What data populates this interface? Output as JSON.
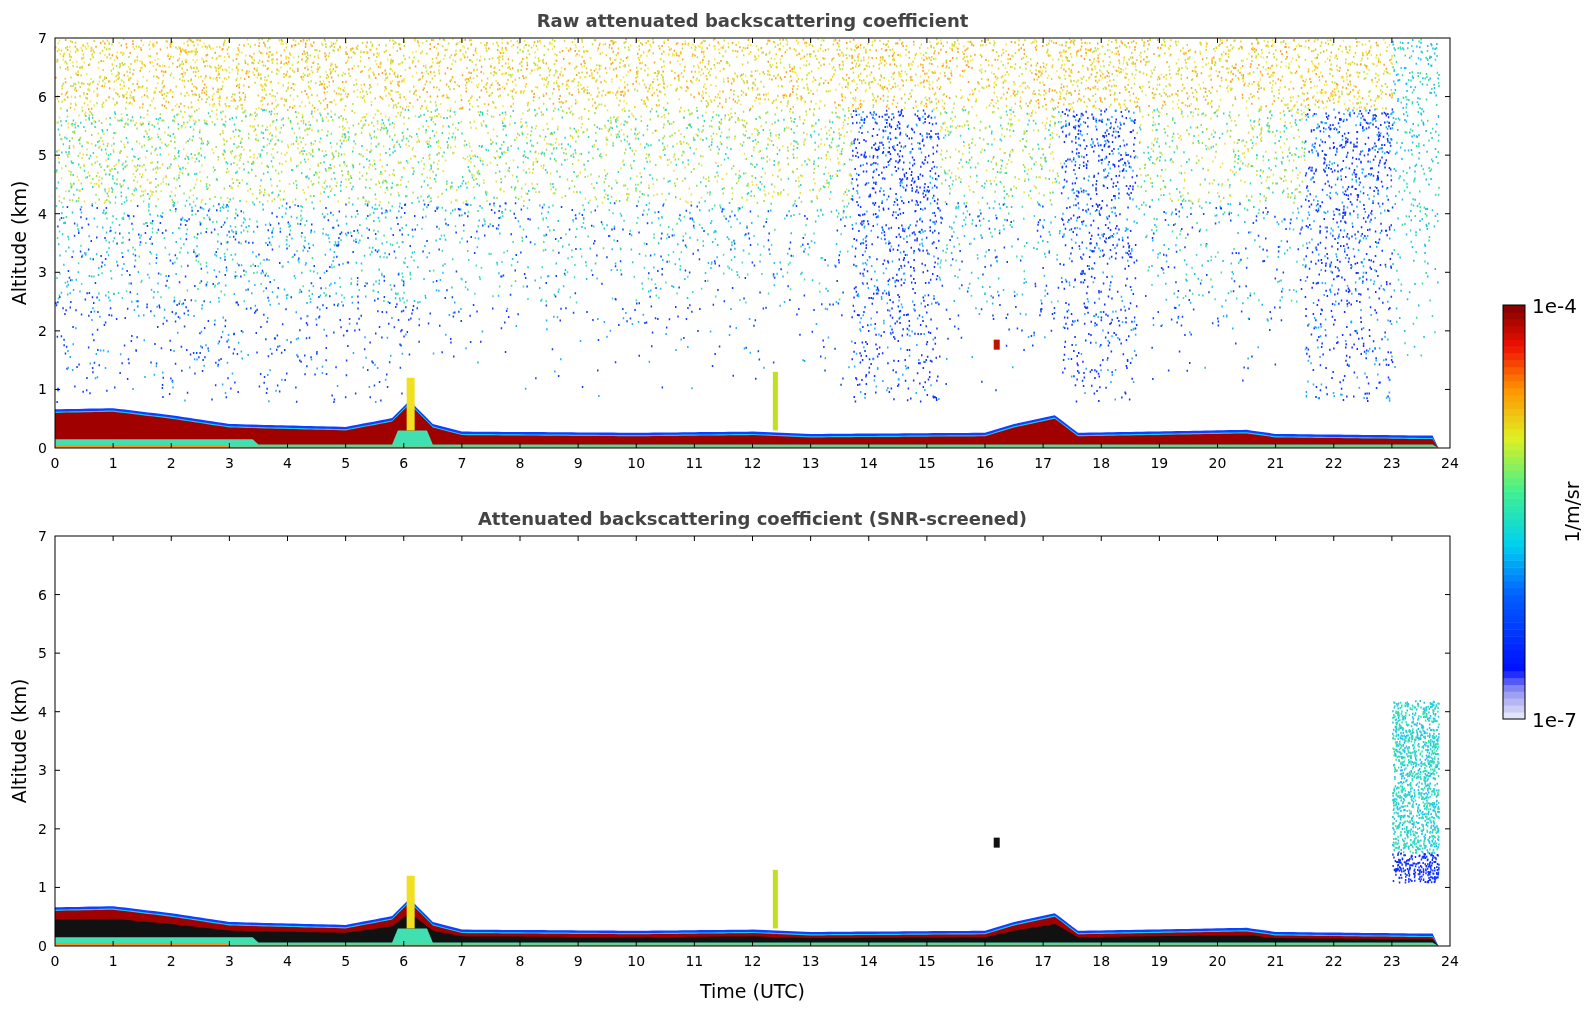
{
  "panels": [
    {
      "kind": "raw",
      "title": "Raw attenuated backscattering coefficient",
      "ylabel": "Altitude (km)",
      "yticks": [
        "7",
        "6",
        "5",
        "4",
        "3",
        "2",
        "1",
        "0"
      ],
      "xticks": [
        "0",
        "1",
        "2",
        "3",
        "4",
        "5",
        "6",
        "7",
        "8",
        "9",
        "10",
        "11",
        "12",
        "13",
        "14",
        "15",
        "16",
        "17",
        "18",
        "19",
        "20",
        "21",
        "22",
        "23",
        "24"
      ]
    },
    {
      "kind": "screened",
      "title": "Attenuated backscattering coefficient (SNR-screened)",
      "ylabel": "Altitude (km)",
      "xlabel": "Time (UTC)",
      "yticks": [
        "7",
        "6",
        "5",
        "4",
        "3",
        "2",
        "1",
        "0"
      ],
      "xticks": [
        "0",
        "1",
        "2",
        "3",
        "4",
        "5",
        "6",
        "7",
        "8",
        "9",
        "10",
        "11",
        "12",
        "13",
        "14",
        "15",
        "16",
        "17",
        "18",
        "19",
        "20",
        "21",
        "22",
        "23",
        "24"
      ]
    }
  ],
  "colorbar": {
    "label": "1/m/sr",
    "max_label": "1e-4",
    "min_label": "1e-7"
  }
}
